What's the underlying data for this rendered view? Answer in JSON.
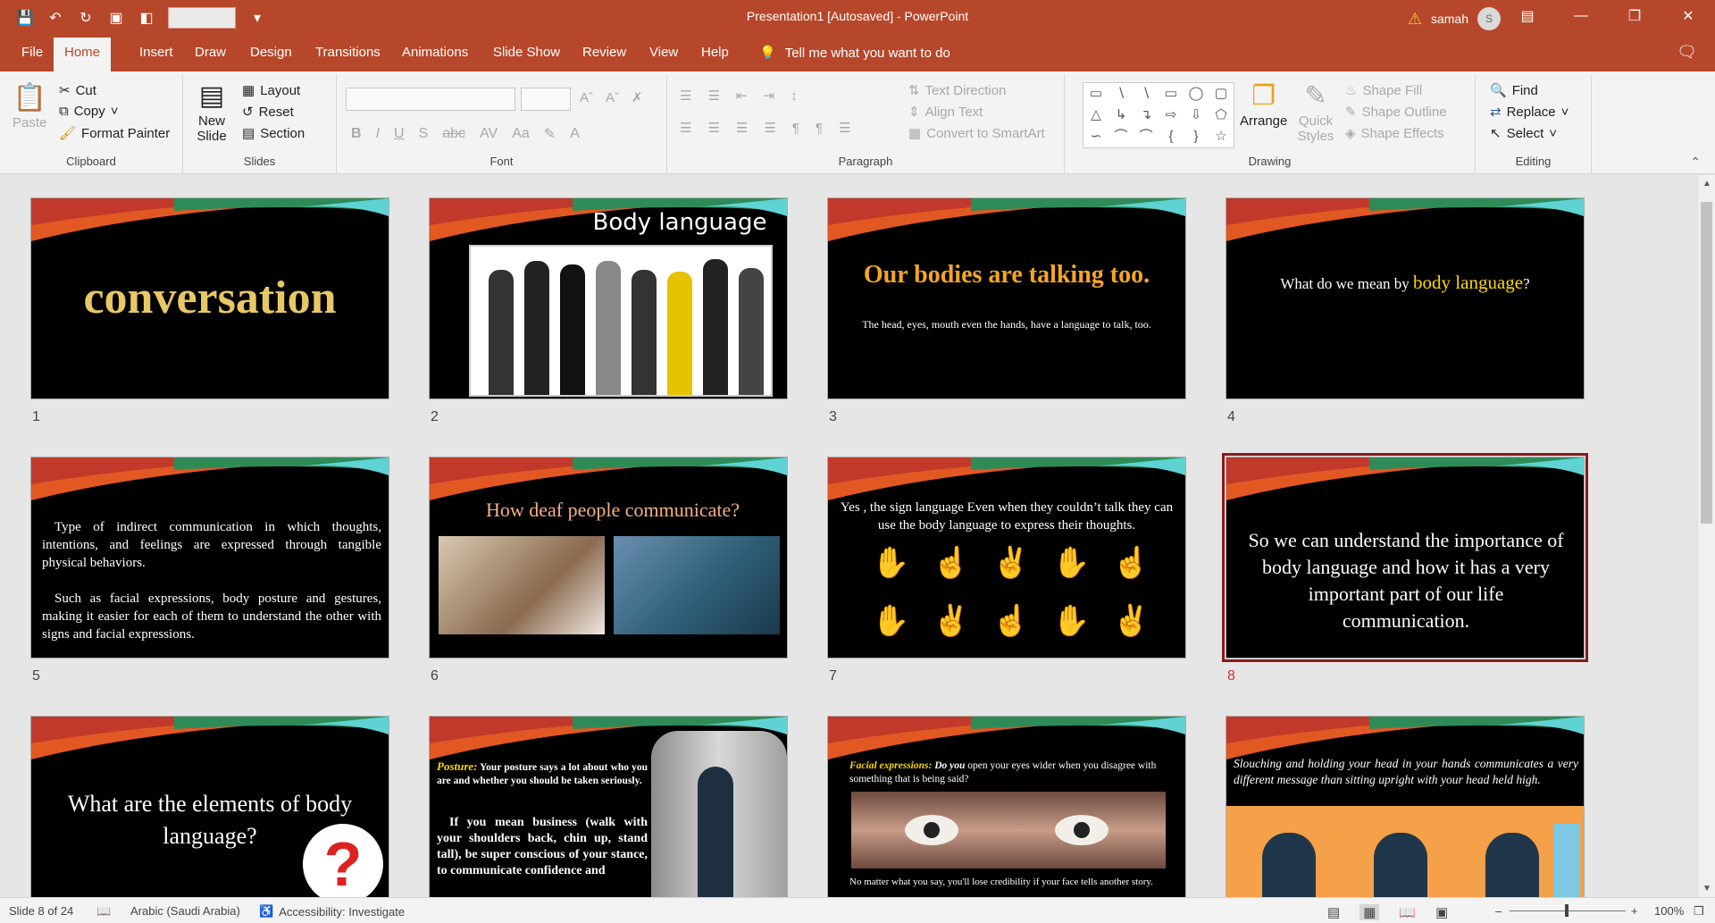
{
  "window": {
    "title": "Presentation1 [Autosaved] - PowerPoint",
    "user": "samah",
    "avatar_initial": "S"
  },
  "tabs": [
    "File",
    "Home",
    "Insert",
    "Draw",
    "Design",
    "Transitions",
    "Animations",
    "Slide Show",
    "Review",
    "View",
    "Help"
  ],
  "tell_me": "Tell me what you want to do",
  "ribbon": {
    "clipboard": {
      "paste": "Paste",
      "cut": "Cut",
      "copy": "Copy",
      "format_painter": "Format Painter",
      "label": "Clipboard"
    },
    "slides": {
      "new_slide": "New Slide",
      "layout": "Layout",
      "reset": "Reset",
      "section": "Section",
      "label": "Slides"
    },
    "font": {
      "label": "Font"
    },
    "paragraph": {
      "text_direction": "Text Direction",
      "align_text": "Align Text",
      "convert": "Convert to SmartArt",
      "label": "Paragraph"
    },
    "drawing": {
      "arrange": "Arrange",
      "quick_styles": "Quick Styles",
      "shape_fill": "Shape Fill",
      "shape_outline": "Shape Outline",
      "shape_effects": "Shape Effects",
      "label": "Drawing"
    },
    "editing": {
      "find": "Find",
      "replace": "Replace",
      "select": "Select",
      "label": "Editing"
    }
  },
  "slides": [
    {
      "n": "1",
      "title": "conversation"
    },
    {
      "n": "2",
      "title": "Body language"
    },
    {
      "n": "3",
      "title": "Our bodies are talking too.",
      "body": "The head, eyes, mouth even the hands, have a language to talk, too."
    },
    {
      "n": "4",
      "pre": "What do we mean by ",
      "hl": "body language",
      "post": "?"
    },
    {
      "n": "5",
      "p1": "Type of indirect communication in which thoughts, intentions, and feelings are expressed through tangible physical behaviors.",
      "p2": "Such as facial expressions, body posture and gestures, making it easier for each of them to understand the other with signs and facial expressions."
    },
    {
      "n": "6",
      "title": "How deaf people communicate?"
    },
    {
      "n": "7",
      "body": "Yes , the sign language Even when they couldn’t talk they can use the body language to express their thoughts."
    },
    {
      "n": "8",
      "body": "So we can understand the importance of body language and how it has a  very important part of our life communication."
    },
    {
      "n": "9",
      "title": "What are the elements of body language?"
    },
    {
      "n": "10",
      "label": "Posture:",
      "p1": " Your posture says a lot about who you are and whether you should be taken seriously.",
      "p2": "If you mean business (walk with your shoulders back, chin up, stand tall), be super conscious of your stance, to communicate confidence and"
    },
    {
      "n": "11",
      "label": "Facial expressions:",
      "q_do": " Do you",
      "q": " open your eyes wider when you disagree with something that is being said?",
      "bottom": "No matter what you say, you'll lose credibility if your face tells another story."
    },
    {
      "n": "12",
      "body": "Slouching and holding your head in your hands communicates a very different message than sitting upright with your head held high."
    }
  ],
  "status": {
    "slide": "Slide 8 of 24",
    "language": "Arabic (Saudi Arabia)",
    "accessibility": "Accessibility: Investigate",
    "zoom": "100%"
  }
}
